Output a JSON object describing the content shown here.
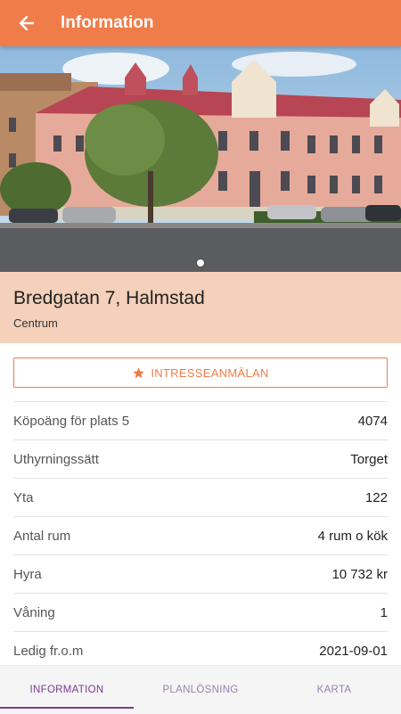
{
  "appbar": {
    "title": "Information",
    "back_icon": "arrow-left-icon"
  },
  "carousel": {
    "slide_count": 1,
    "active_index": 0
  },
  "listing": {
    "address": "Bredgatan 7, Halmstad",
    "area": "Centrum"
  },
  "actions": {
    "interest_label": "INTRESSEANMÄLAN",
    "interest_icon": "star-icon"
  },
  "details": [
    {
      "label": "Köpoäng för plats 5",
      "value": "4074"
    },
    {
      "label": "Uthyrningssätt",
      "value": "Torget"
    },
    {
      "label": "Yta",
      "value": "122"
    },
    {
      "label": "Antal rum",
      "value": "4 rum o kök"
    },
    {
      "label": "Hyra",
      "value": "10 732 kr"
    },
    {
      "label": "Våning",
      "value": "1"
    },
    {
      "label": "Ledig fr.o.m",
      "value": "2021-09-01"
    }
  ],
  "tabs": [
    {
      "label": "INFORMATION",
      "active": true
    },
    {
      "label": "PLANLÖSNING",
      "active": false
    },
    {
      "label": "KARTA",
      "active": false
    }
  ],
  "colors": {
    "primary": "#f07c4a",
    "panel": "#f5d0bb",
    "tab_active": "#7a3d8f"
  }
}
